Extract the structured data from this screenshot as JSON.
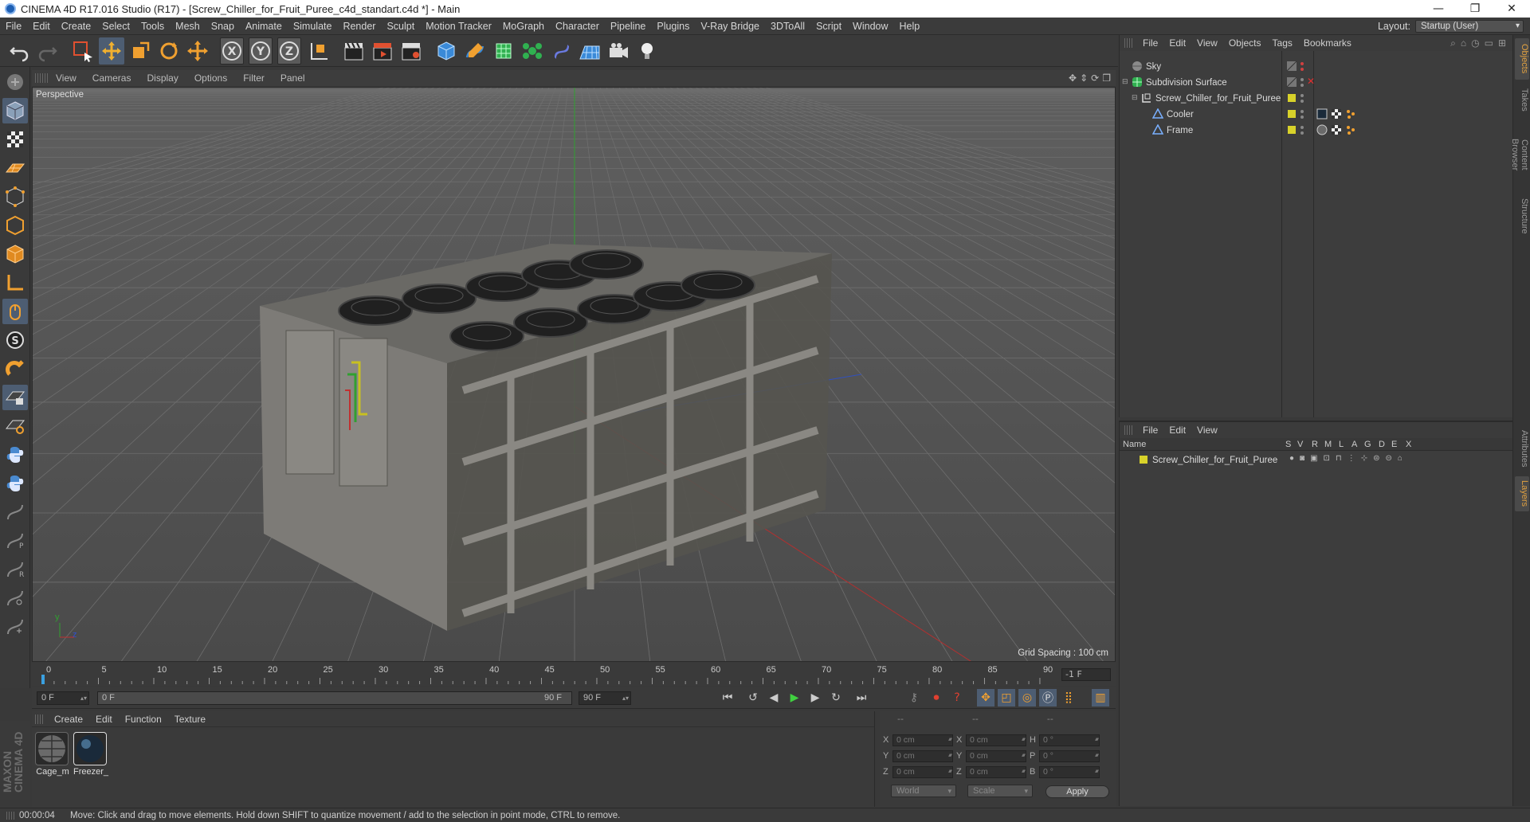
{
  "window": {
    "title": "CINEMA 4D R17.016 Studio (R17) - [Screw_Chiller_for_Fruit_Puree_c4d_standart.c4d *] - Main",
    "minimize": "—",
    "maximize": "❐",
    "close": "✕"
  },
  "menubar": {
    "items": [
      "File",
      "Edit",
      "Create",
      "Select",
      "Tools",
      "Mesh",
      "Snap",
      "Animate",
      "Simulate",
      "Render",
      "Sculpt",
      "Motion Tracker",
      "MoGraph",
      "Character",
      "Pipeline",
      "Plugins",
      "V-Ray Bridge",
      "3DToAll",
      "Script",
      "Window",
      "Help"
    ],
    "layout_label": "Layout:",
    "layout_value": "Startup (User)"
  },
  "toolbar": {
    "axis_x": "X",
    "axis_y": "Y",
    "axis_z": "Z"
  },
  "viewport": {
    "menu": [
      "View",
      "Cameras",
      "Display",
      "Options",
      "Filter",
      "Panel"
    ],
    "label": "Perspective",
    "grid_spacing": "Grid Spacing : 100 cm",
    "axis_y": "y",
    "axis_z": "z"
  },
  "timeline": {
    "ticks": [
      "0",
      "5",
      "10",
      "15",
      "20",
      "25",
      "30",
      "35",
      "40",
      "45",
      "50",
      "55",
      "60",
      "65",
      "70",
      "75",
      "80",
      "85",
      "90"
    ],
    "current_frame_box": "-1 F"
  },
  "transport": {
    "start_field": "0 F",
    "range_start": "0 F",
    "range_end": "90 F",
    "end_field": "90 F"
  },
  "materials": {
    "menu": [
      "Create",
      "Edit",
      "Function",
      "Texture"
    ],
    "items": [
      {
        "name": "Cage_m"
      },
      {
        "name": "Freezer_"
      }
    ]
  },
  "coordinates": {
    "headers": [
      "--",
      "--",
      "--"
    ],
    "rows": [
      {
        "a": "X",
        "av": "0 cm",
        "b": "X",
        "bv": "0 cm",
        "c": "H",
        "cv": "0 °"
      },
      {
        "a": "Y",
        "av": "0 cm",
        "b": "Y",
        "bv": "0 cm",
        "c": "P",
        "cv": "0 °"
      },
      {
        "a": "Z",
        "av": "0 cm",
        "b": "Z",
        "bv": "0 cm",
        "c": "B",
        "cv": "0 °"
      }
    ],
    "world": "World",
    "scale": "Scale",
    "apply": "Apply"
  },
  "objects": {
    "menu": [
      "File",
      "Edit",
      "View",
      "Objects",
      "Tags",
      "Bookmarks"
    ],
    "rows": [
      {
        "name": "Sky"
      },
      {
        "name": "Subdivision Surface"
      },
      {
        "name": "Screw_Chiller_for_Fruit_Puree"
      },
      {
        "name": "Cooler"
      },
      {
        "name": "Frame"
      }
    ]
  },
  "layers": {
    "menu": [
      "File",
      "Edit",
      "View"
    ],
    "header_name": "Name",
    "columns": [
      "S",
      "V",
      "R",
      "M",
      "L",
      "A",
      "G",
      "D",
      "E",
      "X"
    ],
    "rows": [
      {
        "name": "Screw_Chiller_for_Fruit_Puree"
      }
    ]
  },
  "sidetabs": {
    "top": [
      "Objects",
      "Takes",
      "Content Browser",
      "Structure"
    ],
    "bottom": [
      "Attributes",
      "Layers"
    ]
  },
  "status": {
    "time": "00:00:04",
    "message": "Move: Click and drag to move elements. Hold down SHIFT to quantize movement / add to the selection in point mode, CTRL to remove."
  },
  "colors": {
    "accent_blue": "#4d5d72",
    "layer_yellow": "#d8d22a",
    "axis_red": "#c03030",
    "axis_green": "#30b030",
    "axis_blue": "#3050d0"
  }
}
